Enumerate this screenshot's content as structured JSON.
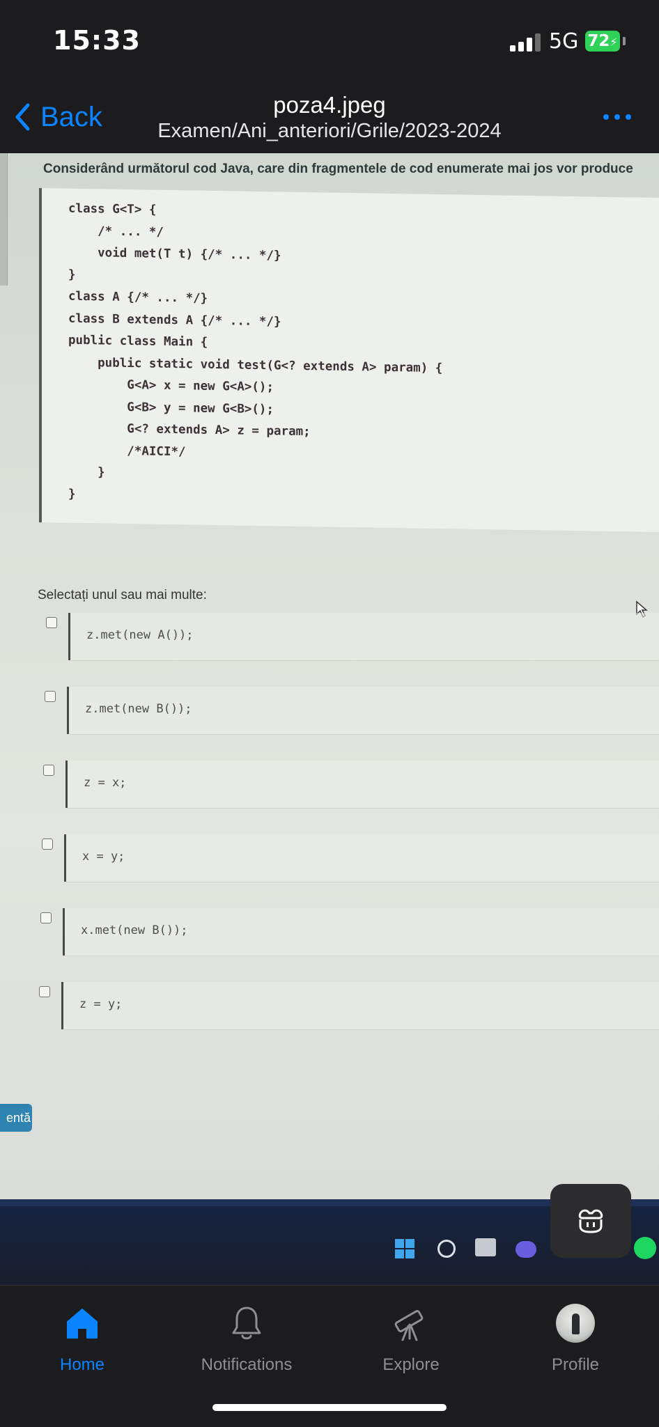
{
  "status_bar": {
    "time": "15:33",
    "network": "5G",
    "battery": "72"
  },
  "nav": {
    "back_label": "Back",
    "title": "poza4.jpeg",
    "subtitle": "Examen/Ani_anteriori/Grile/2023-2024"
  },
  "photo": {
    "question": "Considerând următorul cod Java, care din fragmentele de cod enumerate mai jos vor produce",
    "code": "class G<T> {\n    /* ... */\n    void met(T t) {/* ... */}\n}\nclass A {/* ... */}\nclass B extends A {/* ... */}\npublic class Main {\n    public static void test(G<? extends A> param) {\n        G<A> x = new G<A>();\n        G<B> y = new G<B>();\n        G<? extends A> z = param;\n        /*AICI*/\n    }\n}",
    "select_label": "Selectați unul sau mai multe:",
    "options": [
      {
        "code": "z.met(new A());"
      },
      {
        "code": "z.met(new B());"
      },
      {
        "code": "z = x;"
      },
      {
        "code": "x = y;"
      },
      {
        "code": "x.met(new B());"
      },
      {
        "code": "z = y;"
      }
    ],
    "send_fragment": "entă"
  },
  "tabs": [
    {
      "label": "Home",
      "icon": "home-icon",
      "active": true
    },
    {
      "label": "Notifications",
      "icon": "bell-icon",
      "active": false
    },
    {
      "label": "Explore",
      "icon": "telescope-icon",
      "active": false
    },
    {
      "label": "Profile",
      "icon": "avatar",
      "active": false
    }
  ],
  "colors": {
    "accent": "#0a84ff",
    "battery": "#30d158",
    "background": "#1c1c1e"
  }
}
